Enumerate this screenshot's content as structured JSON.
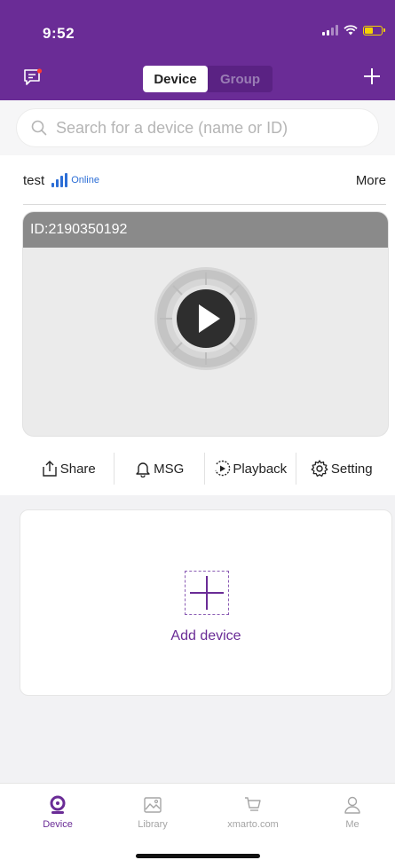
{
  "status_bar": {
    "time": "9:52"
  },
  "nav": {
    "tabs": [
      {
        "label": "Device",
        "active": true
      },
      {
        "label": "Group",
        "active": false
      }
    ]
  },
  "search": {
    "placeholder": "Search for a device (name or ID)"
  },
  "device": {
    "name": "test",
    "status": "Online",
    "more_label": "More",
    "id_label": "ID:2190350192",
    "actions": [
      {
        "label": "Share",
        "icon": "share-icon"
      },
      {
        "label": "MSG",
        "icon": "bell-icon"
      },
      {
        "label": "Playback",
        "icon": "playback-icon"
      },
      {
        "label": "Setting",
        "icon": "gear-icon"
      }
    ]
  },
  "add_device": {
    "label": "Add device"
  },
  "tabbar": {
    "items": [
      {
        "label": "Device",
        "icon": "device-icon",
        "active": true
      },
      {
        "label": "Library",
        "icon": "image-icon",
        "active": false
      },
      {
        "label": "xmarto.com",
        "icon": "cart-icon",
        "active": false
      },
      {
        "label": "Me",
        "icon": "person-icon",
        "active": false
      }
    ]
  },
  "colors": {
    "brand": "#6a2c96",
    "online": "#2c6ed6",
    "battery": "#f5d300"
  }
}
